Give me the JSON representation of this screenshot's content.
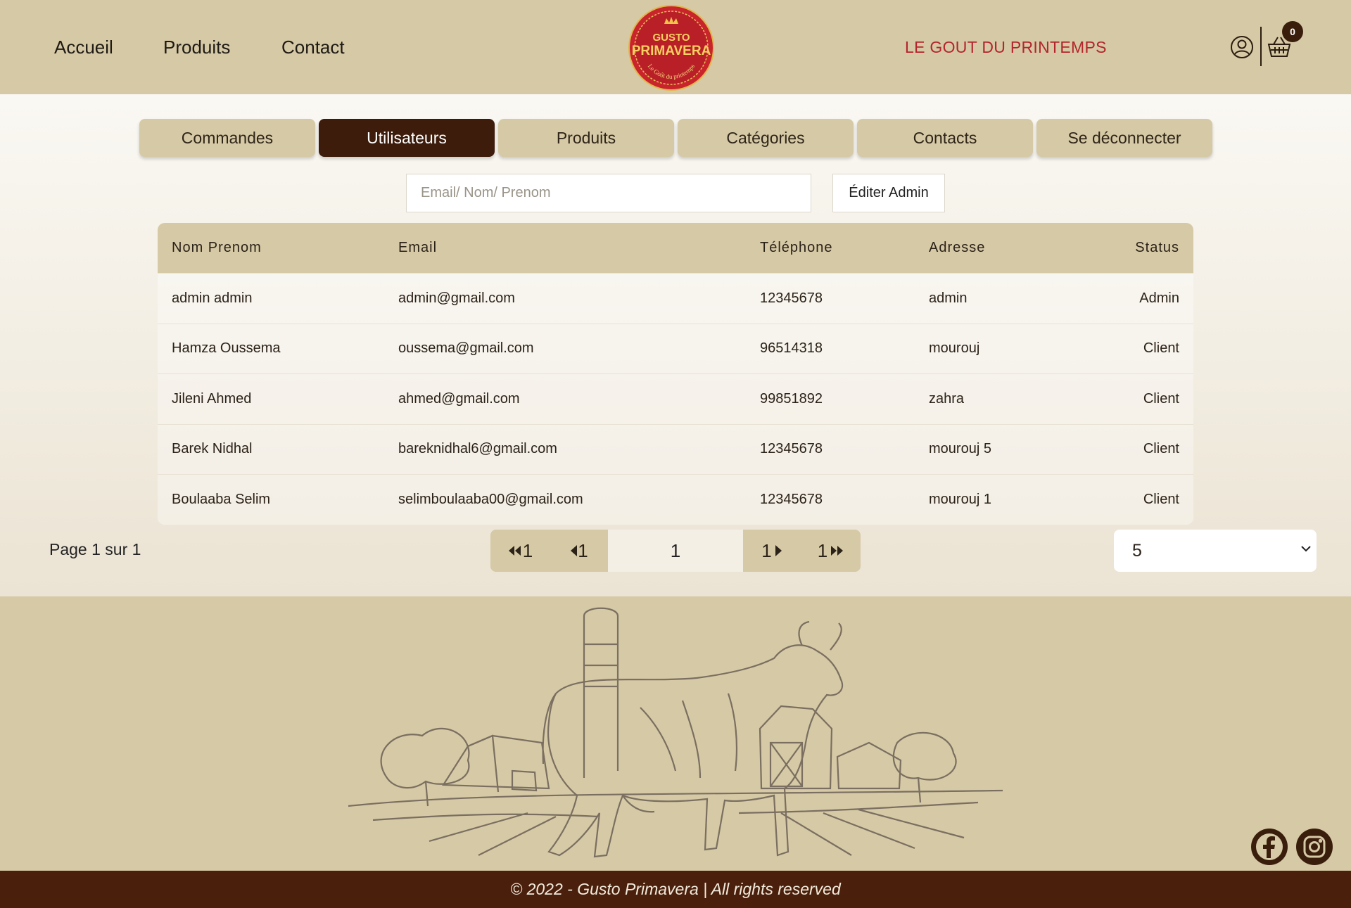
{
  "header": {
    "nav": [
      {
        "label": "Accueil"
      },
      {
        "label": "Produits"
      },
      {
        "label": "Contact"
      }
    ],
    "logo": {
      "line1": "GUSTO",
      "line2": "PRIMAVERA",
      "tagline": "Le Goût du printemps"
    },
    "slogan": "LE GOUT DU PRINTEMPS",
    "cart_count": "0"
  },
  "admin_tabs": [
    {
      "label": "Commandes"
    },
    {
      "label": "Utilisateurs"
    },
    {
      "label": "Produits"
    },
    {
      "label": "Catégories"
    },
    {
      "label": "Contacts"
    },
    {
      "label": "Se déconnecter"
    }
  ],
  "search": {
    "placeholder": "Email/ Nom/ Prenom",
    "value": ""
  },
  "edit_admin_label": "Éditer Admin",
  "table": {
    "headers": [
      "Nom Prenom",
      "Email",
      "Téléphone",
      "Adresse",
      "Status"
    ],
    "rows": [
      [
        "admin admin",
        "admin@gmail.com",
        "12345678",
        "admin",
        "Admin"
      ],
      [
        "Hamza Oussema",
        "oussema@gmail.com",
        "96514318",
        "mourouj",
        "Client"
      ],
      [
        "Jileni Ahmed",
        "ahmed@gmail.com",
        "99851892",
        "zahra",
        "Client"
      ],
      [
        "Barek Nidhal",
        "bareknidhal6@gmail.com",
        "12345678",
        "mourouj 5",
        "Client"
      ],
      [
        "Boulaaba Selim",
        "selimboulaaba00@gmail.com",
        "12345678",
        "mourouj 1",
        "Client"
      ]
    ]
  },
  "pagination": {
    "info": "Page 1 sur 1",
    "first": "1",
    "prev": "1",
    "current": "1",
    "next": "1",
    "last": "1",
    "page_size": "5"
  },
  "footer": {
    "copyright": "© 2022 - Gusto Primavera | All rights reserved"
  },
  "colors": {
    "beige": "#d6c9a6",
    "dark_brown": "#3d1c0b",
    "footer_brown": "#4a200d",
    "slogan_red": "#b3262b"
  }
}
